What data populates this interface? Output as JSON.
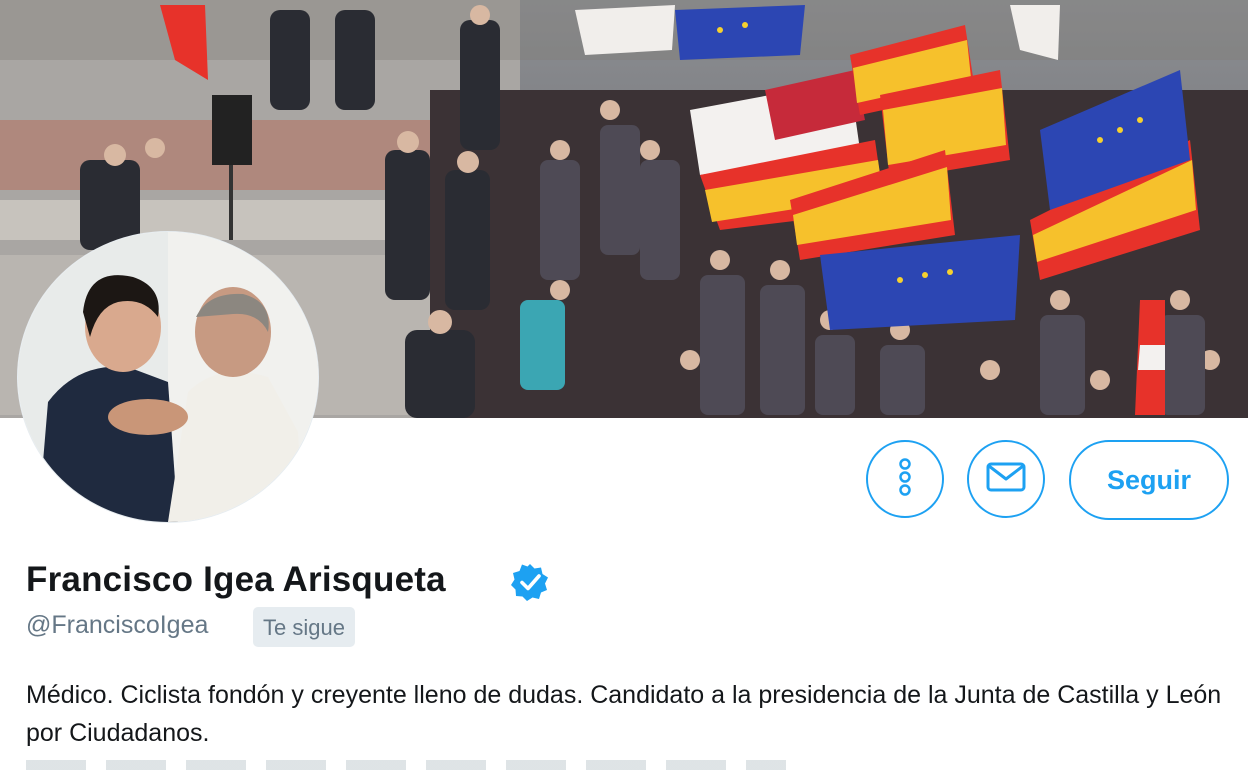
{
  "profile": {
    "display_name": "Francisco Igea Arisqueta",
    "handle": "@FranciscoIgea",
    "follows_you_label": "Te sigue",
    "bio": "Médico. Ciclista fondón y creyente lleno de dudas. Candidato a la presidencia de la Junta de Castilla y León por Ciudadanos.",
    "verified": true
  },
  "actions": {
    "more_icon": "more-vertical-icon",
    "message_icon": "envelope-icon",
    "follow_label": "Seguir"
  },
  "colors": {
    "accent": "#1da1f2",
    "text_primary": "#14171a",
    "text_secondary": "#657786"
  }
}
